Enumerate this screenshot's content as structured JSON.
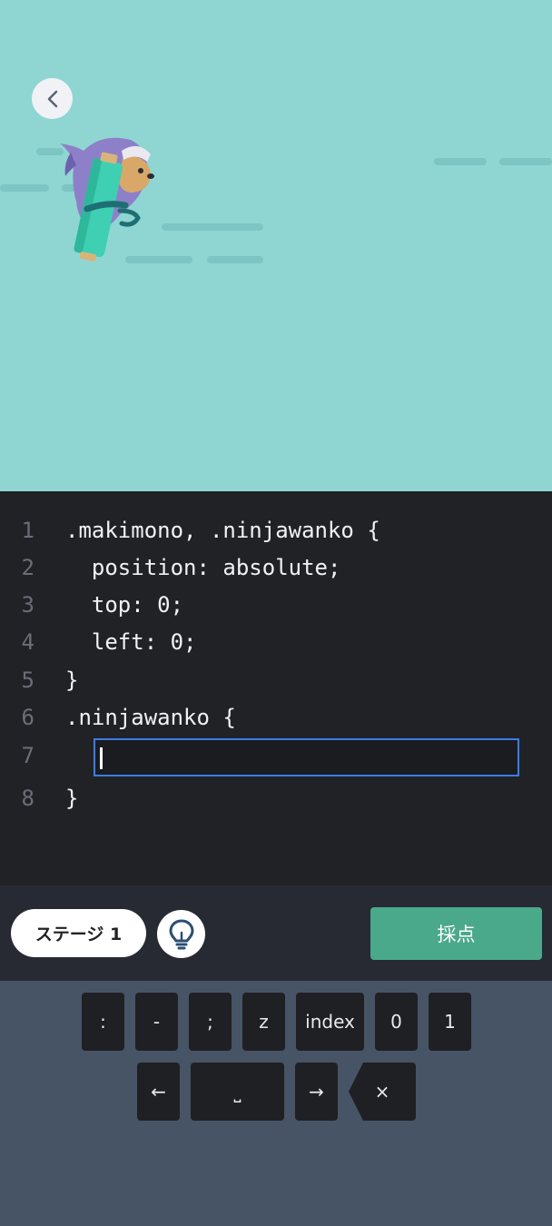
{
  "editor": {
    "lines": [
      {
        "num": "1",
        "text": ".makimono, .ninjawanko {"
      },
      {
        "num": "2",
        "text": "  position: absolute;"
      },
      {
        "num": "3",
        "text": "  top: 0;"
      },
      {
        "num": "4",
        "text": "  left: 0;"
      },
      {
        "num": "5",
        "text": "}"
      },
      {
        "num": "6",
        "text": ".ninjawanko {"
      },
      {
        "num": "7",
        "text": ""
      },
      {
        "num": "8",
        "text": "}"
      }
    ],
    "input_value": ""
  },
  "toolbar": {
    "stage_label": "ステージ 1",
    "grade_label": "採点"
  },
  "keyboard": {
    "row1": [
      ":",
      "-",
      ";",
      "z",
      "index",
      "0",
      "1"
    ],
    "row2": [
      "←",
      "⎵",
      "→",
      "×"
    ]
  },
  "icons": {
    "back": "chevron-left-icon",
    "hint": "lightbulb-icon"
  },
  "colors": {
    "stage_bg": "#8fd6d3",
    "editor_bg": "#202226",
    "accent_green": "#4aa98a",
    "focus_blue": "#3d7ce8"
  }
}
